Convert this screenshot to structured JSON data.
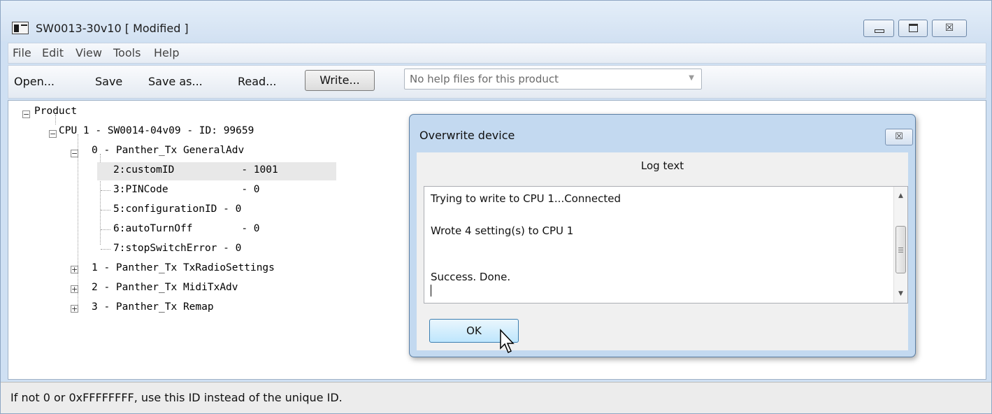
{
  "window": {
    "title": "SW0013-30v10 [ Modified ]",
    "controls": {
      "minimize_icon": "minimize-icon",
      "maximize_icon": "maximize-icon",
      "close_glyph": "☒"
    }
  },
  "menu": [
    "File",
    "Edit",
    "View",
    "Tools",
    "Help"
  ],
  "toolbar": {
    "open": "Open...",
    "save": "Save",
    "save_as": "Save as...",
    "read": "Read...",
    "write": "Write...",
    "help_combo": "No help files for this product",
    "combo_arrow": "▼"
  },
  "tree": {
    "root": "Product",
    "cpu": "CPU 1 - SW0014-04v09 - ID: 99659",
    "groups": [
      {
        "label": "0 - Panther_Tx GeneralAdv",
        "expanded": true
      },
      {
        "label": "1 - Panther_Tx TxRadioSettings",
        "expanded": false
      },
      {
        "label": "2 - Panther_Tx MidiTxAdv",
        "expanded": false
      },
      {
        "label": "3 - Panther_Tx Remap",
        "expanded": false
      }
    ],
    "settings": [
      {
        "label": "2:customID           - 1001",
        "selected": true
      },
      {
        "label": "3:PINCode            - 0",
        "selected": false
      },
      {
        "label": "5:configurationID - 0",
        "selected": false
      },
      {
        "label": "6:autoTurnOff        - 0",
        "selected": false
      },
      {
        "label": "7:stopSwitchError - 0",
        "selected": false
      }
    ],
    "expander_open": "−",
    "expander_closed": "+"
  },
  "status": "If not 0 or 0xFFFFFFFF, use this ID instead of the unique ID.",
  "dialog": {
    "title": "Overwrite device",
    "close_glyph": "☒",
    "log_header": "Log text",
    "log_lines": [
      "Trying to write to CPU 1...Connected",
      "Wrote 4 setting(s) to CPU 1",
      "Success. Done."
    ],
    "scroll_up": "▲",
    "scroll_down": "▼",
    "ok": "OK"
  },
  "colors": {
    "window_frame": "#cfe0f3",
    "dialog_frame": "#c3d9f0",
    "ok_button": "#bee6fd",
    "selection": "#e8e8e8"
  }
}
